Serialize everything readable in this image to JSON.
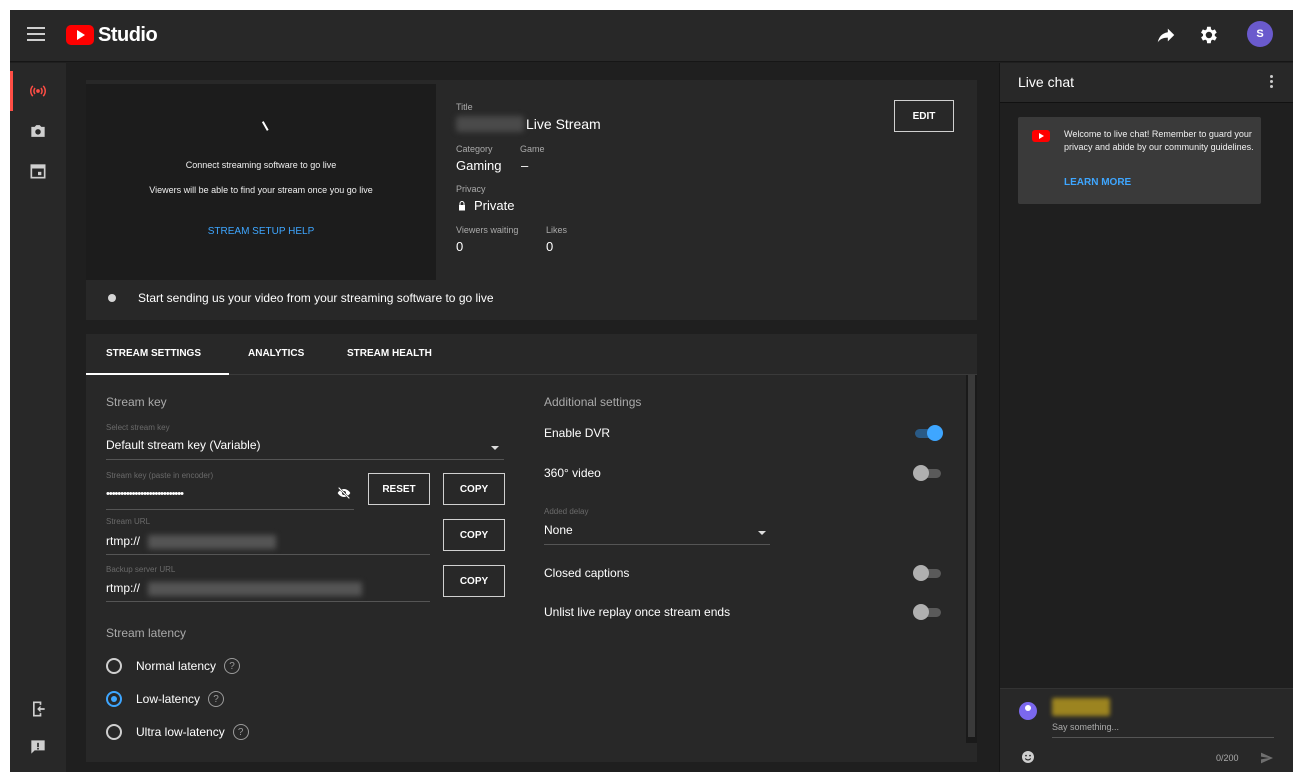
{
  "app": {
    "logo_text": "Studio",
    "avatar_initial": "S"
  },
  "icons": {
    "menu": "hamburger-icon",
    "share": "share-arrow-icon",
    "settings": "gear-icon",
    "nav": [
      "live-broadcast-icon",
      "camera-icon",
      "calendar-icon",
      "exit-icon",
      "feedback-icon"
    ]
  },
  "preview": {
    "connect_text": "Connect streaming software to go live",
    "viewers_text": "Viewers will be able to find your stream once you go live",
    "help_link": "STREAM SETUP HELP"
  },
  "meta": {
    "title_label": "Title",
    "title_value": "Live Stream",
    "category_label": "Category",
    "category_value": "Gaming",
    "game_label": "Game",
    "game_value": "–",
    "privacy_label": "Privacy",
    "privacy_value": "Private",
    "viewers_label": "Viewers waiting",
    "viewers_value": "0",
    "likes_label": "Likes",
    "likes_value": "0",
    "edit_label": "EDIT"
  },
  "status": {
    "text": "Start sending us your video from your streaming software to go live"
  },
  "tabs": [
    {
      "label": "STREAM SETTINGS",
      "active": true
    },
    {
      "label": "ANALYTICS",
      "active": false
    },
    {
      "label": "STREAM HEALTH",
      "active": false
    }
  ],
  "stream_key": {
    "section_title": "Stream key",
    "select_label": "Select stream key",
    "select_value": "Default stream key (Variable)",
    "key_label": "Stream key (paste in encoder)",
    "key_value": "•••••••••••••••••••••••••••",
    "reset_label": "RESET",
    "copy_label": "COPY",
    "url_label": "Stream URL",
    "url_value": "rtmp://",
    "backup_label": "Backup server URL",
    "backup_value": "rtmp://"
  },
  "latency": {
    "title": "Stream latency",
    "options": [
      {
        "label": "Normal latency",
        "selected": false
      },
      {
        "label": "Low-latency",
        "selected": true
      },
      {
        "label": "Ultra low-latency",
        "selected": false
      }
    ],
    "help_glyph": "?"
  },
  "additional": {
    "title": "Additional settings",
    "dvr_label": "Enable DVR",
    "dvr_on": true,
    "video360_label": "360° video",
    "video360_on": false,
    "delay_label": "Added delay",
    "delay_value": "None",
    "captions_label": "Closed captions",
    "captions_on": false,
    "unlist_label": "Unlist live replay once stream ends",
    "unlist_on": false
  },
  "chat": {
    "title": "Live chat",
    "welcome_text": "Welcome to live chat! Remember to guard your privacy and abide by our community guidelines.",
    "learn_more": "LEARN MORE",
    "input_placeholder": "Say something...",
    "char_count": "0/200"
  },
  "colors": {
    "accent_blue": "#3ea6ff",
    "brand_red": "#ff0000",
    "background": "#1f1f1f",
    "surface": "#282828"
  }
}
